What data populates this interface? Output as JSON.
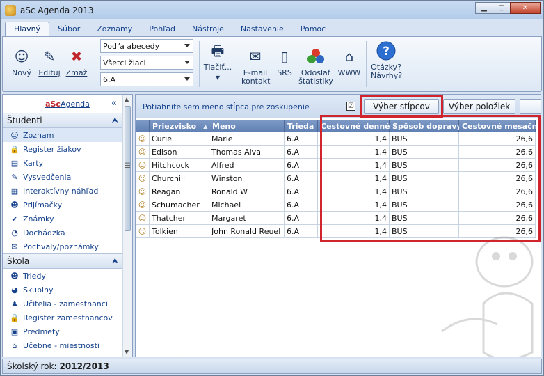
{
  "window": {
    "title": "aSc Agenda 2013"
  },
  "ribbon_tabs": [
    {
      "label": "Hlavný",
      "active": true
    },
    {
      "label": "Súbor"
    },
    {
      "label": "Zoznamy"
    },
    {
      "label": "Pohľad"
    },
    {
      "label": "Nástroje"
    },
    {
      "label": "Nastavenie"
    },
    {
      "label": "Pomoc"
    }
  ],
  "ribbon": {
    "new_label": "Nový",
    "edit_label": "Edituj",
    "delete_label": "Zmaž",
    "dropdown_sort": "Podľa abecedy",
    "dropdown_filter": "Všetci žiaci",
    "dropdown_class": "6.A",
    "print_label": "Tlačiť...",
    "email_label": "E-mail kontakt",
    "sms_label": "SRS",
    "stats_label": "Odoslať štatistiky",
    "www_label": "WWW",
    "help_label": "Otázky? Návrhy?"
  },
  "sidebar": {
    "brand_prefix": "aSc",
    "brand_suffix": "Agenda",
    "collapse_icon": "«",
    "sections": [
      {
        "title": "Študenti",
        "items": [
          {
            "label": "Zoznam",
            "icon": "student-icon",
            "glyph": "☺",
            "selected": true
          },
          {
            "label": "Register žiakov",
            "icon": "lock-icon",
            "glyph": "🔒"
          },
          {
            "label": "Karty",
            "icon": "card-icon",
            "glyph": "▤"
          },
          {
            "label": "Vysvedčenia",
            "icon": "certificate-icon",
            "glyph": "✎"
          },
          {
            "label": "Interaktívny náhľad",
            "icon": "preview-icon",
            "glyph": "▦"
          },
          {
            "label": "Prijímačky",
            "icon": "admissions-icon",
            "glyph": "☻"
          },
          {
            "label": "Známky",
            "icon": "grades-icon",
            "glyph": "✔"
          },
          {
            "label": "Dochádzka",
            "icon": "attendance-icon",
            "glyph": "◔"
          },
          {
            "label": "Pochvaly/poznámky",
            "icon": "praise-icon",
            "glyph": "✉"
          }
        ]
      },
      {
        "title": "Škola",
        "items": [
          {
            "label": "Triedy",
            "icon": "classes-icon",
            "glyph": "☻"
          },
          {
            "label": "Skupiny",
            "icon": "groups-icon",
            "glyph": "◕"
          },
          {
            "label": "Učitelia - zamestnanci",
            "icon": "teachers-icon",
            "glyph": "♟"
          },
          {
            "label": "Register zamestnancov",
            "icon": "lock-icon",
            "glyph": "🔒"
          },
          {
            "label": "Predmety",
            "icon": "subjects-icon",
            "glyph": "▣"
          },
          {
            "label": "Učebne - miestnosti",
            "icon": "rooms-icon",
            "glyph": "⌂"
          }
        ]
      }
    ]
  },
  "grid": {
    "group_hint": "Potiahnite sem meno stĺpca pre zoskupenie",
    "column_select_label": "Výber stĺpcov",
    "item_select_label": "Výber položiek",
    "checkbox_glyph": "☑",
    "sort_glyph": "▲",
    "columns": [
      "Priezvisko",
      "Meno",
      "Trieda",
      "Cestovné denné",
      "Spôsob dopravy",
      "Cestovné mesačné"
    ],
    "rows": [
      [
        "Curie",
        "Marie",
        "6.A",
        "1,4",
        "BUS",
        "26,6"
      ],
      [
        "Edison",
        "Thomas Alva",
        "6.A",
        "1,4",
        "BUS",
        "26,6"
      ],
      [
        "Hitchcock",
        "Alfred",
        "6.A",
        "1,4",
        "BUS",
        "26,6"
      ],
      [
        "Churchill",
        "Winston",
        "6.A",
        "1,4",
        "BUS",
        "26,6"
      ],
      [
        "Reagan",
        "Ronald W.",
        "6.A",
        "1,4",
        "BUS",
        "26,6"
      ],
      [
        "Schumacher",
        "Michael",
        "6.A",
        "1,4",
        "BUS",
        "26,6"
      ],
      [
        "Thatcher",
        "Margaret",
        "6.A",
        "1,4",
        "BUS",
        "26,6"
      ],
      [
        "Tolkien",
        "John Ronald Reuel",
        "6.A",
        "1,4",
        "BUS",
        "26,6"
      ]
    ]
  },
  "status": {
    "label": "Školský rok:",
    "value": "2012/2013"
  },
  "colors": {
    "highlight": "#d0252d",
    "header": "#6f8dbd",
    "accent": "#15428b"
  }
}
